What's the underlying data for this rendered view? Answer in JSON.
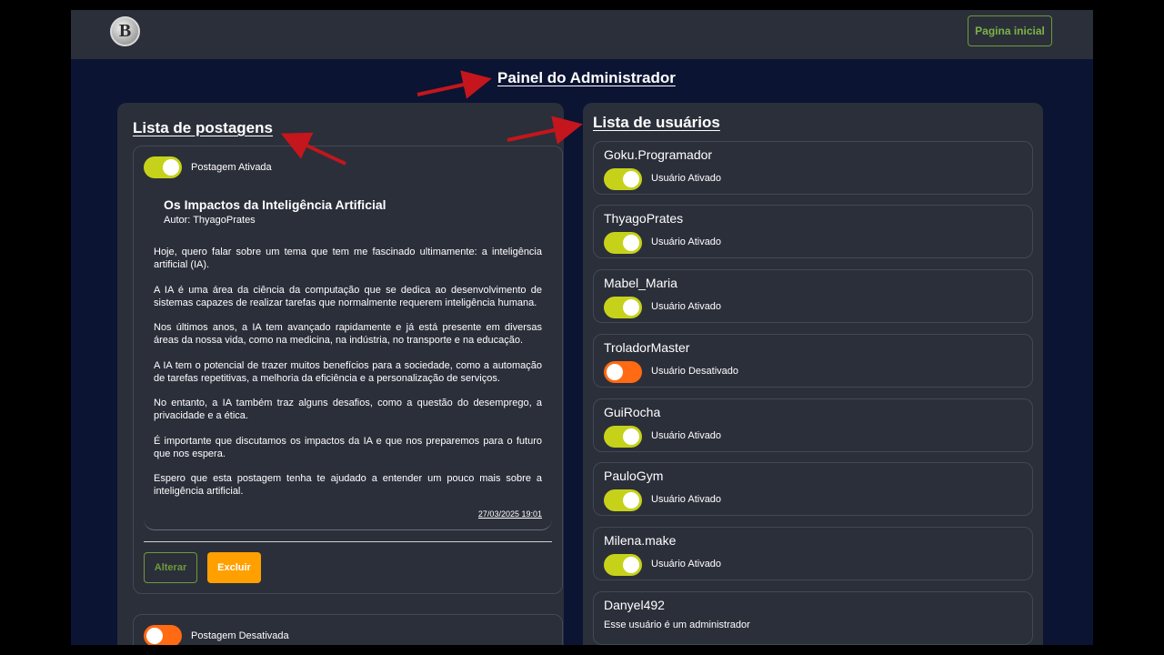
{
  "header": {
    "logo_letter": "B",
    "home_button": "Pagina inicial"
  },
  "page_title": "Painel do Administrador",
  "posts_panel": {
    "title": "Lista de postagens",
    "post": {
      "status": "Postagem Ativada",
      "title": "Os Impactos da Inteligência Artificial",
      "author": "Autor: ThyagoPrates",
      "paragraphs": [
        "Hoje, quero falar sobre um tema que tem me fascinado ultimamente: a inteligência artificial (IA).",
        "A IA é uma área da ciência da computação que se dedica ao desenvolvimento de sistemas capazes de realizar tarefas que normalmente requerem inteligência humana.",
        "Nos últimos anos, a IA tem avançado rapidamente e já está presente em diversas áreas da nossa vida, como na medicina, na indústria, no transporte e na educação.",
        "A IA tem o potencial de trazer muitos benefícios para a sociedade, como a automação de tarefas repetitivas, a melhoria da eficiência e a personalização de serviços.",
        "No entanto, a IA também traz alguns desafios, como a questão do desemprego, a privacidade e a ética.",
        "É importante que discutamos os impactos da IA e que nos preparemos para o futuro que nos espera.",
        "Espero que esta postagem tenha te ajudado a entender um pouco mais sobre a inteligência artificial."
      ],
      "date": "27/03/2025 19:01",
      "edit_button": "Alterar",
      "delete_button": "Excluir"
    },
    "post2": {
      "status": "Postagem Desativada"
    }
  },
  "users_panel": {
    "title": "Lista de usuários",
    "users": [
      {
        "name": "Goku.Programador",
        "status": "Usuário Ativado"
      },
      {
        "name": "ThyagoPrates",
        "status": "Usuário Ativado"
      },
      {
        "name": "Mabel_Maria",
        "status": "Usuário Ativado"
      },
      {
        "name": "TroladorMaster",
        "status": "Usuário Desativado"
      },
      {
        "name": "GuiRocha",
        "status": "Usuário Ativado"
      },
      {
        "name": "PauloGym",
        "status": "Usuário Ativado"
      },
      {
        "name": "Milena.make",
        "status": "Usuário Ativado"
      },
      {
        "name": "Danyel492",
        "status": "Esse usuário é um administrador"
      }
    ]
  },
  "colors": {
    "toggle_on": "#c6d21a",
    "toggle_off": "#ff6a13",
    "annotation_arrow": "#c4161c",
    "accent_green": "#7cb342",
    "delete_orange": "#ffa000"
  }
}
